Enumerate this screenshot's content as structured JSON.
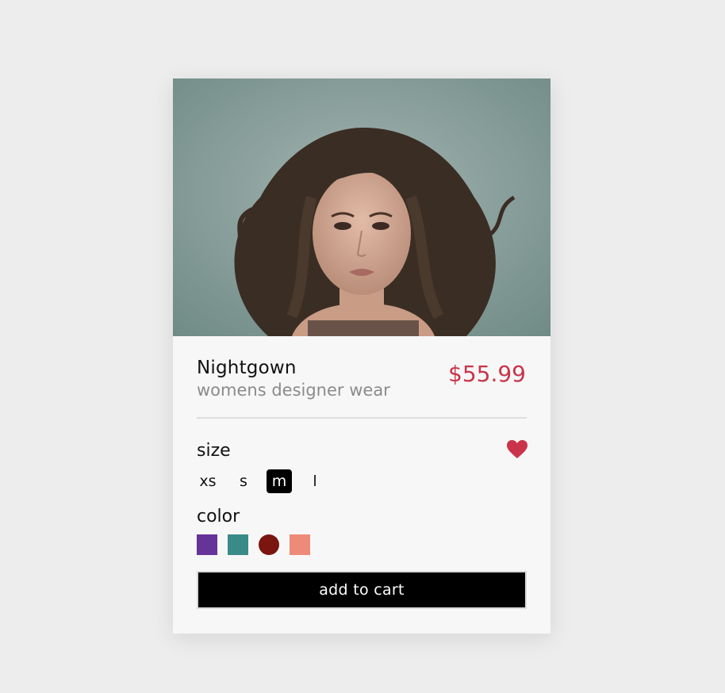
{
  "product": {
    "name": "Nightgown",
    "subtitle": "womens designer wear",
    "price": "$55.99"
  },
  "size": {
    "label": "size",
    "options": [
      "xs",
      "s",
      "m",
      "l"
    ],
    "selected": "m"
  },
  "color": {
    "label": "color",
    "swatches": [
      "#663399",
      "#3a8a87",
      "#7a1510",
      "#ee8a78"
    ]
  },
  "cart": {
    "button_label": "add to cart"
  },
  "favorite": {
    "icon": "heart-icon",
    "color": "#c9344a"
  },
  "colors": {
    "accent": "#c9344a",
    "button_bg": "#000000",
    "card_bg": "#f7f7f7"
  }
}
